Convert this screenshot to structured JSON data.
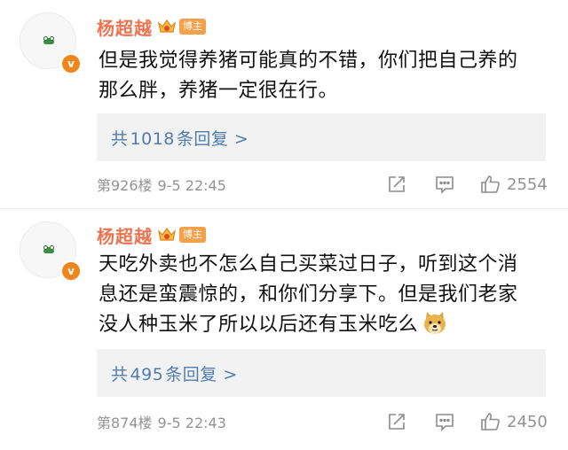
{
  "comments": [
    {
      "username": "杨超越",
      "host_tag": "博主",
      "verified_mark": "v",
      "text_lines": [
        "但是我觉得养猪可能真的不错，你们把自己养的",
        "那么胖，养猪一定很在行。"
      ],
      "reply_prefix": "共",
      "reply_count": "1018",
      "reply_suffix": "条回复 >",
      "floor": "第926楼",
      "time": "9-5 22:45",
      "likes": "2554"
    },
    {
      "username": "杨超越",
      "host_tag": "博主",
      "verified_mark": "v",
      "text_lines": [
        "天吃外卖也不怎么自己买菜过日子，听到这个消",
        "息还是蛮震惊的，和你们分享下。但是我们老家",
        "没人种玉米了所以以后还有玉米吃么"
      ],
      "reply_prefix": "共",
      "reply_count": "495",
      "reply_suffix": "条回复 >",
      "floor": "第874楼",
      "time": "9-5 22:43",
      "likes": "2450"
    }
  ],
  "icons": {
    "share": "share-icon",
    "comment": "comment-icon",
    "like": "thumbs-up-icon",
    "crown": "crown-icon",
    "emoji": "doge-emoji-icon"
  },
  "colors": {
    "username": "#eb7350",
    "reply_link": "#507daf",
    "meta": "#939393",
    "reply_bg": "#f2f2f2",
    "verified": "#f0851c"
  }
}
